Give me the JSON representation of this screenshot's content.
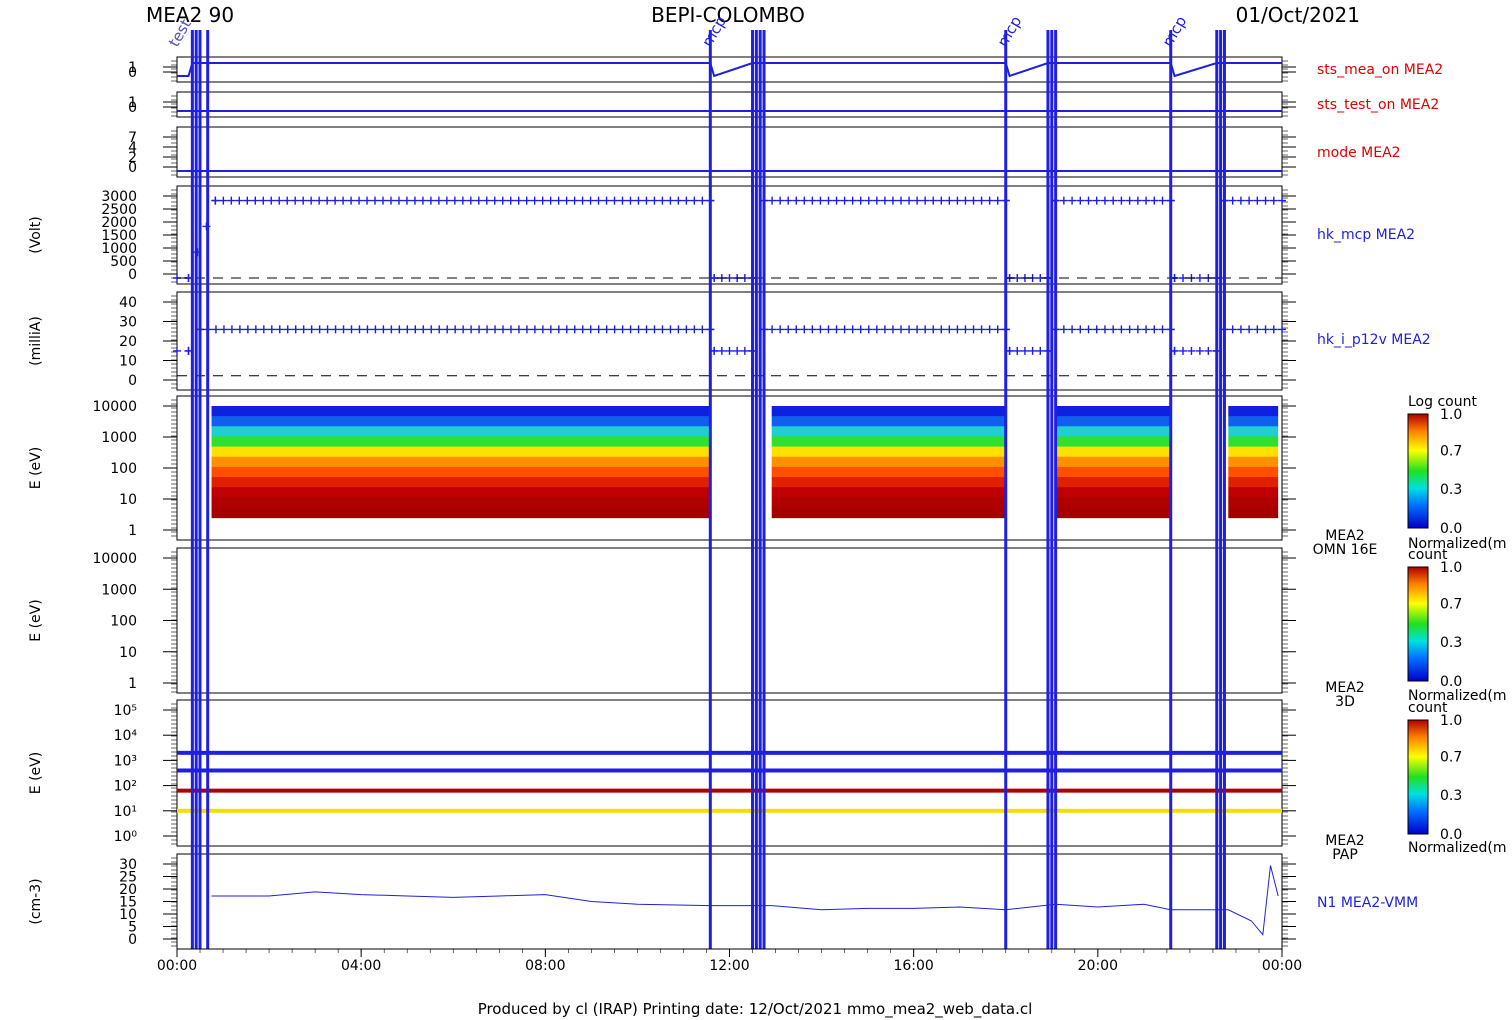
{
  "header": {
    "left": "MEA2 90",
    "center": "BEPI-COLOMBO",
    "right": "01/Oct/2021"
  },
  "footer": "Produced by cl (IRAP)   Printing date: 12/Oct/2021   mmo_mea2_web_data.cl",
  "time_axis": {
    "ticks": [
      "00:00",
      "04:00",
      "08:00",
      "12:00",
      "16:00",
      "20:00",
      "00:00"
    ]
  },
  "colors": {
    "blue": "#1f1fe0",
    "red": "#e00000",
    "black": "#000000"
  },
  "chart_data": [
    {
      "type": "line",
      "id": "sts_mea_on",
      "title": "sts_mea_on MEA2",
      "ylabel": "",
      "ylim": [
        0,
        1
      ],
      "ytick_labels": [
        "1",
        "0"
      ],
      "x": [
        "00:00",
        "00:15",
        "00:20",
        "11:35",
        "11:40",
        "12:30",
        "18:00",
        "18:05",
        "18:55",
        "21:35",
        "21:40",
        "22:35",
        "24:00"
      ],
      "values": [
        0,
        0,
        1,
        1,
        0,
        1,
        1,
        0,
        1,
        1,
        0,
        1,
        1
      ]
    },
    {
      "type": "line",
      "id": "sts_test_on",
      "title": "sts_test_on MEA2",
      "ylabel": "",
      "ylim": [
        0,
        1
      ],
      "ytick_labels": [
        "1",
        "0"
      ],
      "x": [
        "00:00",
        "24:00"
      ],
      "values": [
        0,
        0
      ]
    },
    {
      "type": "line",
      "id": "mode",
      "title": "mode MEA2",
      "ylabel": "",
      "ylim": [
        0,
        7
      ],
      "ytick_labels": [
        "7",
        "4",
        "2",
        "0"
      ],
      "x": [
        "00:00",
        "24:00"
      ],
      "values": [
        0,
        0
      ]
    },
    {
      "type": "scatter",
      "id": "hk_mcp",
      "title": "hk_mcp MEA2",
      "ylabel": "(Volt)",
      "ylim": [
        0,
        3000
      ],
      "ytick_labels": [
        "3000",
        "2500",
        "2000",
        "1500",
        "1000",
        "500",
        "0"
      ],
      "x": [
        "00:00",
        "00:15",
        "00:50",
        "11:35",
        "11:40",
        "12:30",
        "12:45",
        "18:00",
        "18:05",
        "18:55",
        "19:05",
        "21:35",
        "21:40",
        "22:35",
        "22:45",
        "24:00"
      ],
      "values": [
        0,
        0,
        2700,
        2700,
        0,
        0,
        2700,
        2700,
        0,
        0,
        2700,
        2700,
        0,
        0,
        2700,
        2700
      ]
    },
    {
      "type": "scatter",
      "id": "hk_i_p12v",
      "title": "hk_i_p12v MEA2",
      "ylabel": "(milliA)",
      "ylim": [
        -5,
        47
      ],
      "ytick_labels": [
        "40",
        "30",
        "20",
        "10",
        "0"
      ],
      "x": [
        "00:00",
        "00:15",
        "00:30",
        "11:35",
        "11:40",
        "12:30",
        "12:45",
        "18:00",
        "18:05",
        "18:55",
        "19:05",
        "21:35",
        "21:40",
        "22:35",
        "22:45",
        "24:00"
      ],
      "values": [
        15,
        15,
        28,
        28,
        15,
        15,
        28,
        28,
        15,
        15,
        28,
        28,
        15,
        15,
        28,
        28
      ]
    },
    {
      "type": "heatmap",
      "id": "omn16e",
      "title": "MEA2 OMN 16E",
      "ylabel": "E (eV)",
      "yscale": "log",
      "ylim": [
        1,
        10000
      ],
      "ytick_labels": [
        "10000",
        "1000",
        "100",
        "10",
        "1"
      ],
      "colorbar": {
        "title": "Log count",
        "range": [
          0.0,
          1.0
        ],
        "tick_labels": [
          "1.0",
          "0.7",
          "0.3",
          "0.0"
        ]
      },
      "active_intervals": [
        [
          "00:45",
          "11:35"
        ],
        [
          "12:55",
          "18:00"
        ],
        [
          "19:05",
          "21:35"
        ],
        [
          "22:50",
          "23:55"
        ]
      ]
    },
    {
      "type": "heatmap",
      "id": "3d",
      "title": "MEA2 3D",
      "ylabel": "E (eV)",
      "yscale": "log",
      "ylim": [
        1,
        10000
      ],
      "ytick_labels": [
        "10000",
        "1000",
        "100",
        "10",
        "1"
      ],
      "colorbar": {
        "title": "Normalized(m",
        "subtitle": "count",
        "range": [
          0.0,
          1.0
        ],
        "tick_labels": [
          "1.0",
          "0.7",
          "0.3",
          "0.0"
        ]
      },
      "active_intervals": []
    },
    {
      "type": "heatmap",
      "id": "pap",
      "title": "MEA2 PAP",
      "ylabel": "E (eV)",
      "yscale": "log",
      "ylim": [
        1,
        100000
      ],
      "ytick_labels": [
        "10⁵",
        "10⁴",
        "10³",
        "10²",
        "10¹",
        "10⁰"
      ],
      "colorbar": {
        "title": "Normalized(m",
        "subtitle": "count",
        "range": [
          0.0,
          1.0
        ],
        "tick_labels": [
          "1.0",
          "0.7",
          "0.3",
          "0.0"
        ]
      },
      "bands_log10E": [
        3.3,
        2.6,
        1.8,
        1.0
      ]
    },
    {
      "type": "line",
      "id": "n1",
      "title": "N1 MEA2-VMM",
      "ylabel": "(cm-3)",
      "ylim": [
        0,
        30
      ],
      "ytick_labels": [
        "30",
        "25",
        "20",
        "15",
        "10",
        "5",
        "0"
      ],
      "x": [
        "00:45",
        "02:00",
        "03:00",
        "04:00",
        "05:00",
        "06:00",
        "07:00",
        "08:00",
        "09:00",
        "10:00",
        "11:35",
        "12:55",
        "14:00",
        "15:00",
        "16:00",
        "17:00",
        "18:00",
        "19:05",
        "20:00",
        "21:00",
        "21:35",
        "22:50",
        "23:20",
        "23:35",
        "23:45",
        "23:55"
      ],
      "values": [
        17,
        17,
        18.5,
        17.5,
        17,
        16.5,
        17,
        17.5,
        15,
        14,
        13.5,
        13.5,
        12,
        12.5,
        12.5,
        13,
        12,
        14,
        13,
        14,
        12,
        12,
        8,
        3,
        28,
        17
      ]
    },
    {
      "type": "line",
      "id": "panel5_right_label",
      "title": "",
      "note_right": "MEA2 OMN 16E"
    },
    {
      "type": "line",
      "id": "annotations",
      "title": "",
      "labels": [
        "test",
        "mcp",
        "mcp",
        "mcp"
      ]
    }
  ]
}
